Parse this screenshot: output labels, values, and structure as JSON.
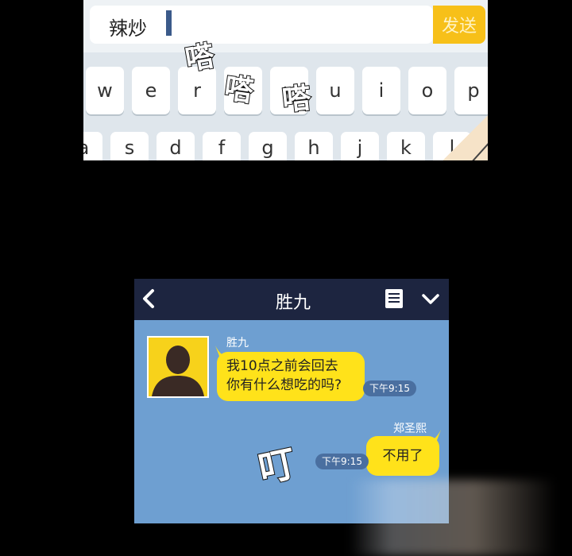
{
  "keyboard_panel": {
    "input_text": "辣炒",
    "send_label": "发送",
    "keys_row1": [
      "w",
      "e",
      "r",
      "t",
      "y",
      "u",
      "i",
      "o",
      "p"
    ],
    "keys_row2": [
      "a",
      "s",
      "d",
      "f",
      "g",
      "h",
      "j",
      "k",
      "l"
    ],
    "sfx_typing": [
      "嗒",
      "嗒",
      "嗒"
    ]
  },
  "chat_panel": {
    "title": "胜九",
    "back_icon": "chevron-left-icon",
    "menu_icon": "list-icon",
    "collapse_icon": "chevron-down-icon",
    "messages": [
      {
        "sender": "胜九",
        "lines": [
          "我10点之前会回去",
          "你有什么想吃的吗?"
        ],
        "time": "下午9:15"
      },
      {
        "sender": "郑圣熙",
        "lines": [
          "不用了"
        ],
        "time": "下午9:15"
      }
    ],
    "sfx_notify": "叮"
  },
  "colors": {
    "send_button": "#f7c019",
    "bubble": "#ffe21a",
    "chat_bg": "#6e9fd1",
    "header_bg": "#1d2540"
  }
}
